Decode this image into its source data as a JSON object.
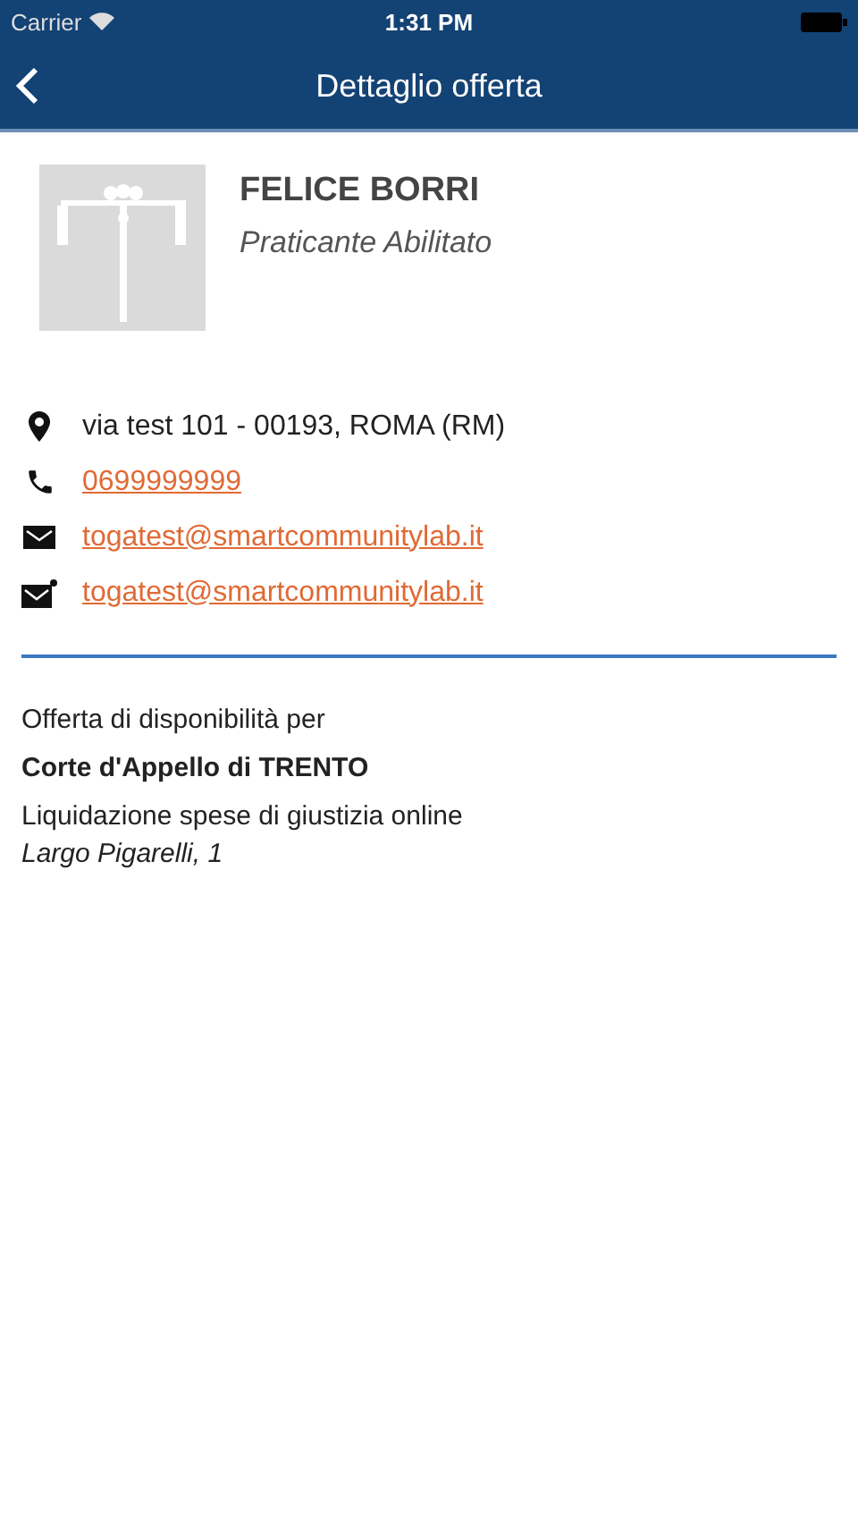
{
  "status_bar": {
    "carrier": "Carrier",
    "time": "1:31 PM"
  },
  "nav_bar": {
    "title": "Dettaglio offerta"
  },
  "profile": {
    "name": "FELICE BORRI",
    "role": "Praticante Abilitato"
  },
  "contacts": [
    {
      "kind": "address",
      "text": "via test 101 - 00193, ROMA (RM)"
    },
    {
      "kind": "phone",
      "text": "0699999999"
    },
    {
      "kind": "email",
      "text": "togatest@smartcommunitylab.it"
    },
    {
      "kind": "pec",
      "text": "togatest@smartcommunitylab.it"
    }
  ],
  "offer": {
    "intro": "Offerta di disponibilità per",
    "court": "Corte d'Appello di TRENTO",
    "service": "Liquidazione spese di giustizia online",
    "address": "Largo Pigarelli, 1"
  }
}
